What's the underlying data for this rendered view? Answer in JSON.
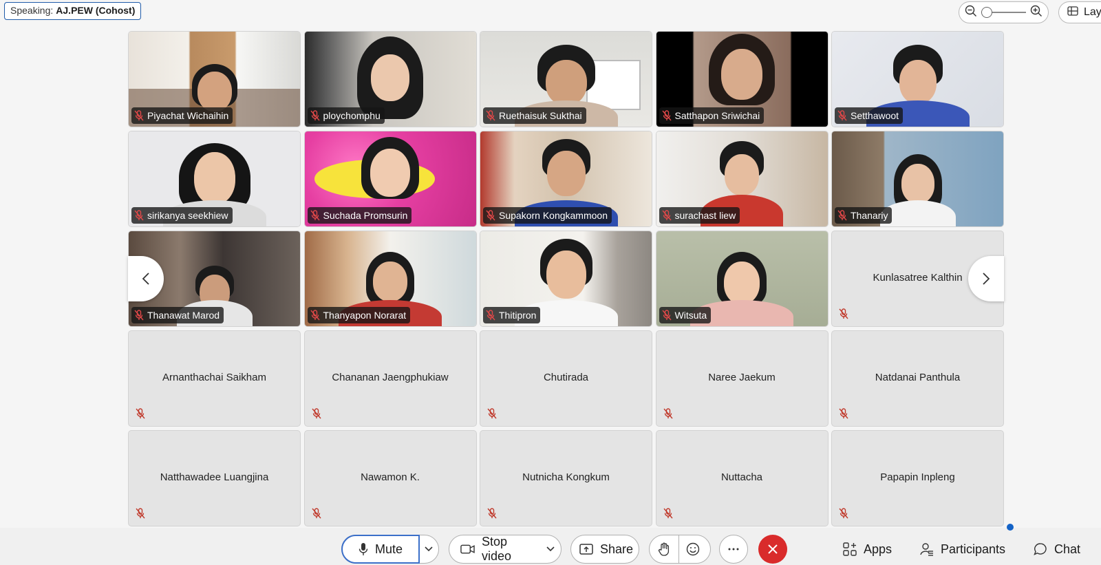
{
  "speaking": {
    "label": "Speaking:",
    "name": "AJ.PEW (Cohost)"
  },
  "layout_button": {
    "label": "Lay"
  },
  "grid_page": {
    "row1": [
      {
        "name": "Piyachat Wichaihin"
      },
      {
        "name": "ploychomphu"
      },
      {
        "name": "Ruethaisuk Sukthai"
      },
      {
        "name": "Satthapon Sriwichai"
      },
      {
        "name": "Setthawoot"
      }
    ],
    "row2": [
      {
        "name": "sirikanya seekhiew"
      },
      {
        "name": "Suchada Promsurin"
      },
      {
        "name": "Supakorn Kongkammoon"
      },
      {
        "name": "surachast liew"
      },
      {
        "name": "Thanariy"
      }
    ],
    "row3": [
      {
        "name": "Thanawat Marod"
      },
      {
        "name": "Thanyapon Norarat"
      },
      {
        "name": "Thitipron"
      },
      {
        "name": "Witsuta"
      },
      {
        "name": "Kunlasatree Kalthin"
      }
    ],
    "row4": [
      {
        "name": "Arnanthachai Saikham"
      },
      {
        "name": "Chananan Jaengphukiaw"
      },
      {
        "name": "Chutirada"
      },
      {
        "name": "Naree Jaekum"
      },
      {
        "name": "Natdanai Panthula"
      }
    ],
    "row5": [
      {
        "name": "Natthawadee Luangjina"
      },
      {
        "name": "Nawamon K."
      },
      {
        "name": "Nutnicha Kongkum"
      },
      {
        "name": "Nuttacha"
      },
      {
        "name": "Papapin Inpleng"
      }
    ]
  },
  "toolbar": {
    "mute_label": "Mute",
    "stop_video_label": "Stop video",
    "share_label": "Share",
    "apps_label": "Apps",
    "participants_label": "Participants",
    "chat_label": "Chat"
  },
  "colors": {
    "leave_red": "#d92b2b",
    "mute_focus_blue": "#3b6fc9",
    "notification_dot": "#1463c7",
    "muted_icon_red": "#c0392b"
  }
}
